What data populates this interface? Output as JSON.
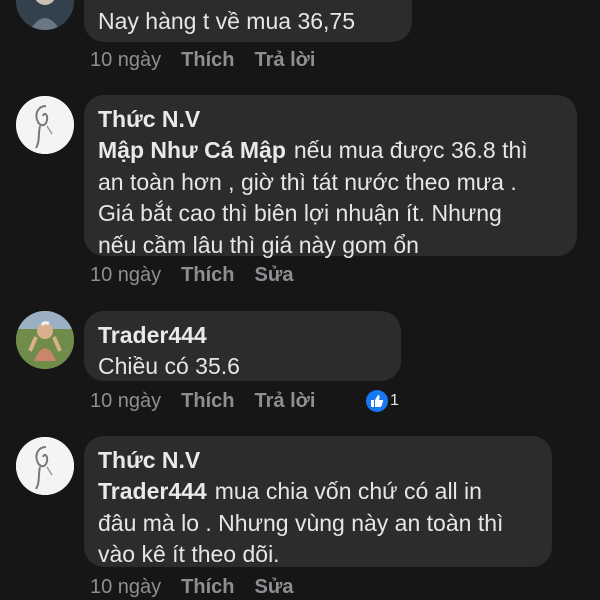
{
  "comments": [
    {
      "author": "",
      "mention": "",
      "text": "Nay hàng t về mua 36,75",
      "time": "10 ngày",
      "like": "Thích",
      "action": "Trả lời",
      "avatar": "photo-avatar"
    },
    {
      "author": "Thức N.V",
      "mention": "Mập Như Cá Mập",
      "lines": [
        "nếu mua được 36.8 thì",
        "an toàn hơn , giờ thì tát nước theo mưa .",
        "Giá bắt cao thì biên lợi nhuận ít. Nhưng",
        "nếu cầm lâu thì giá này gom ổn"
      ],
      "time": "10 ngày",
      "like": "Thích",
      "action": "Sửa",
      "avatar": "sketch-avatar"
    },
    {
      "author": "Trader444",
      "mention": "",
      "text": "Chiều có 35.6",
      "time": "10 ngày",
      "like": "Thích",
      "action": "Trả lời",
      "reaction_count": "1",
      "reaction_icon": "thumbs-up-icon",
      "avatar": "photo-avatar"
    },
    {
      "author": "Thức N.V",
      "mention": "Trader444",
      "lines": [
        "mua chia vốn chứ có all in",
        "đâu mà lo . Nhưng vùng này an toàn thì",
        "vào kê ít theo dõi."
      ],
      "time": "10 ngày",
      "like": "Thích",
      "action": "Sửa",
      "avatar": "sketch-avatar"
    }
  ],
  "colors": {
    "background": "#161616",
    "bubble": "#2c2c2e",
    "text": "#e6e6e6",
    "meta": "#8e8e93",
    "like_badge": "#1877f2"
  }
}
